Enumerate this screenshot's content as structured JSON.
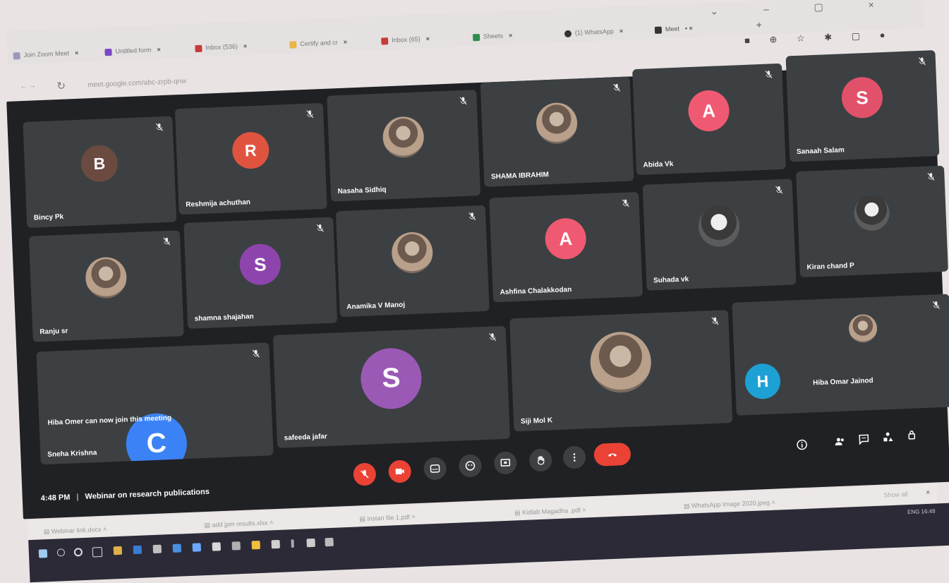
{
  "browser": {
    "tabs": [
      {
        "label": "Join Zoom Meet"
      },
      {
        "label": "Untitled form"
      },
      {
        "label": "Inbox (536)"
      },
      {
        "label": "Certify and cr"
      },
      {
        "label": "Inbox (65)"
      },
      {
        "label": "Sheets"
      },
      {
        "label": "(1) WhatsApp"
      },
      {
        "label": "Meet"
      }
    ],
    "url": "meet.google.com/abc-zrpb-qnw"
  },
  "tiles": [
    {
      "name": "Bincy Pk",
      "initial": "B",
      "color": "#6b4a3f"
    },
    {
      "name": "Reshmija achuthan",
      "initial": "R",
      "color": "#e0543f"
    },
    {
      "name": "Nasaha Sidhiq",
      "initial": "",
      "color": ""
    },
    {
      "name": "SHAMA IBRAHIM",
      "initial": "",
      "color": ""
    },
    {
      "name": "Abida Vk",
      "initial": "A",
      "color": "#ef5a72"
    },
    {
      "name": "Sanaah Salam",
      "initial": "S",
      "color": "#e2516a"
    },
    {
      "name": "Ranju sr",
      "initial": "",
      "color": ""
    },
    {
      "name": "shamna shajahan",
      "initial": "S",
      "color": "#8e44ad"
    },
    {
      "name": "Anamika V Manoj",
      "initial": "",
      "color": ""
    },
    {
      "name": "Ashfina Chalakkodan",
      "initial": "A",
      "color": "#ef5a72"
    },
    {
      "name": "Suhada vk",
      "initial": "",
      "color": ""
    },
    {
      "name": "Kiran chand P",
      "initial": "",
      "color": ""
    },
    {
      "name": "Sneha Krishna",
      "initial": "C",
      "color": "#3b82f6"
    },
    {
      "name": "safeeda jafar",
      "initial": "S",
      "color": "#9b59b6"
    },
    {
      "name": "Siji Mol K",
      "initial": "",
      "color": ""
    },
    {
      "name": "Hiba Omar Jainod",
      "initial": "H",
      "color": "#1da1d4"
    }
  ],
  "notice": "Hiba Omer can now join this meeting",
  "meeting": {
    "time": "4:48 PM",
    "separator": "|",
    "title": "Webinar on research publications"
  },
  "downloads": [
    {
      "label": "Webinar link.docx"
    },
    {
      "label": "add jpm results.xlsx"
    },
    {
      "label": "instan file 1.pdf"
    },
    {
      "label": "Kidlab Magadha .pdf"
    },
    {
      "label": "WhatsApp Image 2020.jpeg"
    }
  ],
  "download_bar": {
    "show_all": "Show all",
    "close": "×"
  },
  "taskbar": {
    "clock": "ENG 16:48"
  },
  "colors": {
    "meet_bg": "#202124",
    "tile_bg": "#3c4043",
    "end_call": "#ea4335"
  }
}
